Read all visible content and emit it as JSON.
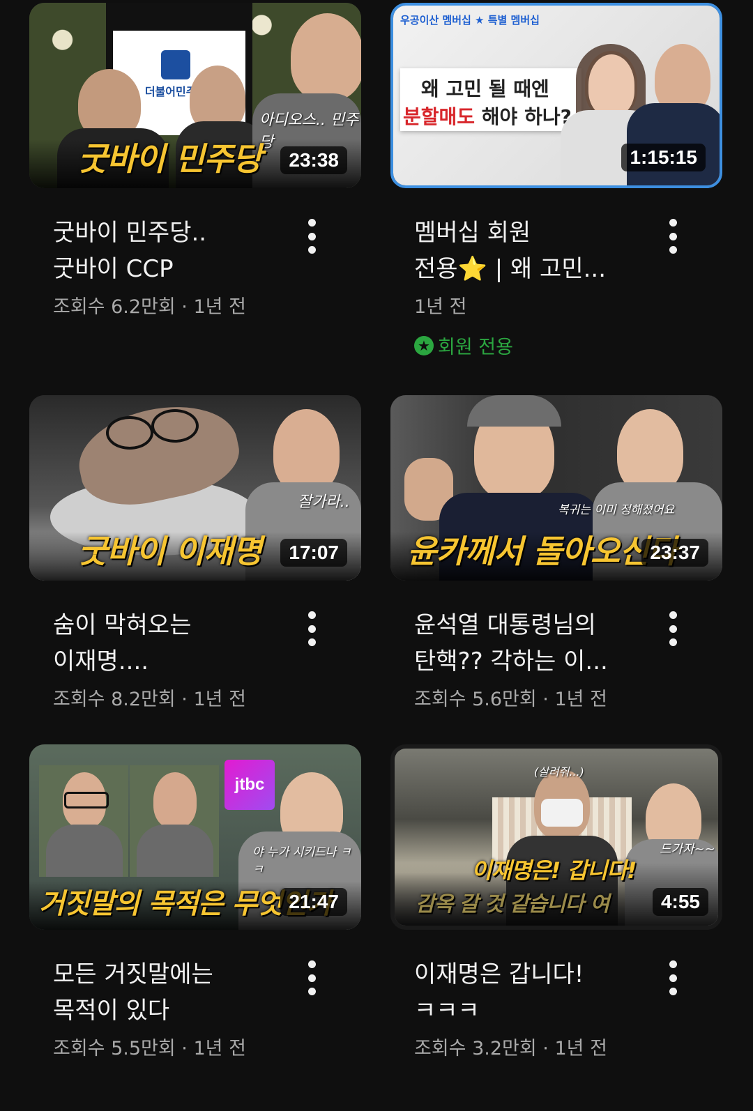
{
  "videos": [
    {
      "thumb_caption": "굿바이 민주당",
      "duration": "23:38",
      "title": "굿바이 민주당..\n굿바이 CCP",
      "meta": "조회수 6.2만회 · 1년 전",
      "thumb_text": "아디오스.. 민주당",
      "logo_text": "더불어민주당"
    },
    {
      "thumb_caption": "",
      "duration": "1:15:15",
      "title": "멤버십 회원\n전용⭐ | 왜 고민...",
      "meta": "1년 전",
      "badge": "회원 전용",
      "thumb_top": "우공이산 멤버십 ★ 특별 멤버십",
      "thumb_line1": "왜 고민 될 때엔",
      "thumb_line2_red": "분할매도",
      "thumb_line2_rest": " 해야 하나?"
    },
    {
      "thumb_caption": "굿바이 이재명",
      "duration": "17:07",
      "title": "숨이 막혀오는\n이재명....",
      "meta": "조회수 8.2만회 · 1년 전",
      "thumb_text": "잘가라.."
    },
    {
      "thumb_caption": "윤카께서 돌아오신다",
      "duration": "23:37",
      "title": "윤석열 대통령님의\n탄핵?? 각하는 이...",
      "meta": "조회수 5.6만회 · 1년 전",
      "thumb_text": "복귀는 이미 정해졌어요"
    },
    {
      "thumb_caption": "거짓말의 목적은 무엇인가",
      "duration": "21:47",
      "title": "모든 거짓말에는\n목적이 있다",
      "meta": "조회수 5.5만회 · 1년 전",
      "thumb_text": "야 누가 시키드나 ㅋㅋ",
      "logo_text": "jtbc"
    },
    {
      "thumb_caption": "이재명은! 갑니다!",
      "duration": "4:55",
      "title": "이재명은 갑니다!\nㅋㅋㅋ",
      "meta": "조회수 3.2만회 · 1년 전",
      "thumb_text": "드가자~~",
      "thumb_text2": "(살려줘...)",
      "thumb_sub": "감옥 갈 것 같습니다 여"
    }
  ],
  "colors": {
    "background": "#0f0f0f",
    "caption_yellow": "#f7c531",
    "member_green": "#2ba640"
  }
}
